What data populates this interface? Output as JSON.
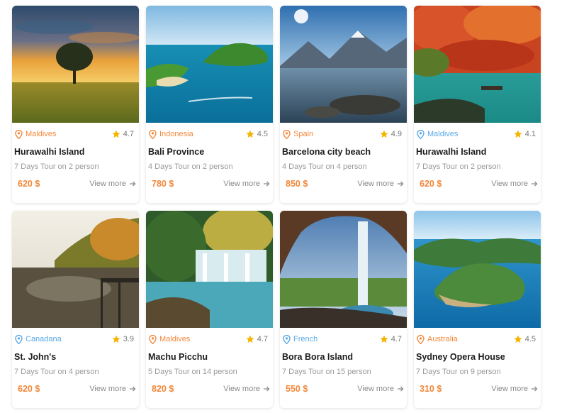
{
  "colors": {
    "accent": "#f2883b",
    "blue_pin": "#5aa9e6",
    "orange_pin": "#f2883b",
    "star": "#f5b400"
  },
  "cards": [
    {
      "location": "Maldives",
      "pin_color": "orange",
      "rating": "4.7",
      "title": "Hurawalhi Island",
      "subtitle": "7 Days Tour on 2 person",
      "price": "620 $",
      "view": "View more"
    },
    {
      "location": "Indonesia",
      "pin_color": "orange",
      "rating": "4.5",
      "title": "Bali Province",
      "subtitle": "4 Days Tour on 2 person",
      "price": "780 $",
      "view": "View more"
    },
    {
      "location": "Spain",
      "pin_color": "orange",
      "rating": "4.9",
      "title": "Barcelona city beach",
      "subtitle": "4 Days Tour on 4 person",
      "price": "850 $",
      "view": "View more"
    },
    {
      "location": "Maldives",
      "pin_color": "blue",
      "rating": "4.1",
      "title": "Hurawalhi Island",
      "subtitle": "7 Days Tour on 2 person",
      "price": "620 $",
      "view": "View more"
    },
    {
      "location": "Canadana",
      "pin_color": "blue",
      "rating": "3.9",
      "title": "St. John's",
      "subtitle": "7 Days Tour on 4 person",
      "price": "620 $",
      "view": "View more"
    },
    {
      "location": "Maldives",
      "pin_color": "orange",
      "rating": "4.7",
      "title": "Machu Picchu",
      "subtitle": "5 Days Tour on 14 person",
      "price": "820 $",
      "view": "View more"
    },
    {
      "location": "French",
      "pin_color": "blue",
      "rating": "4.7",
      "title": "Bora Bora Island",
      "subtitle": "7 Days Tour on 15 person",
      "price": "550 $",
      "view": "View more"
    },
    {
      "location": "Australia",
      "pin_color": "orange",
      "rating": "4.5",
      "title": "Sydney Opera House",
      "subtitle": "7 Days Tour on 9 person",
      "price": "310 $",
      "view": "View more"
    }
  ]
}
